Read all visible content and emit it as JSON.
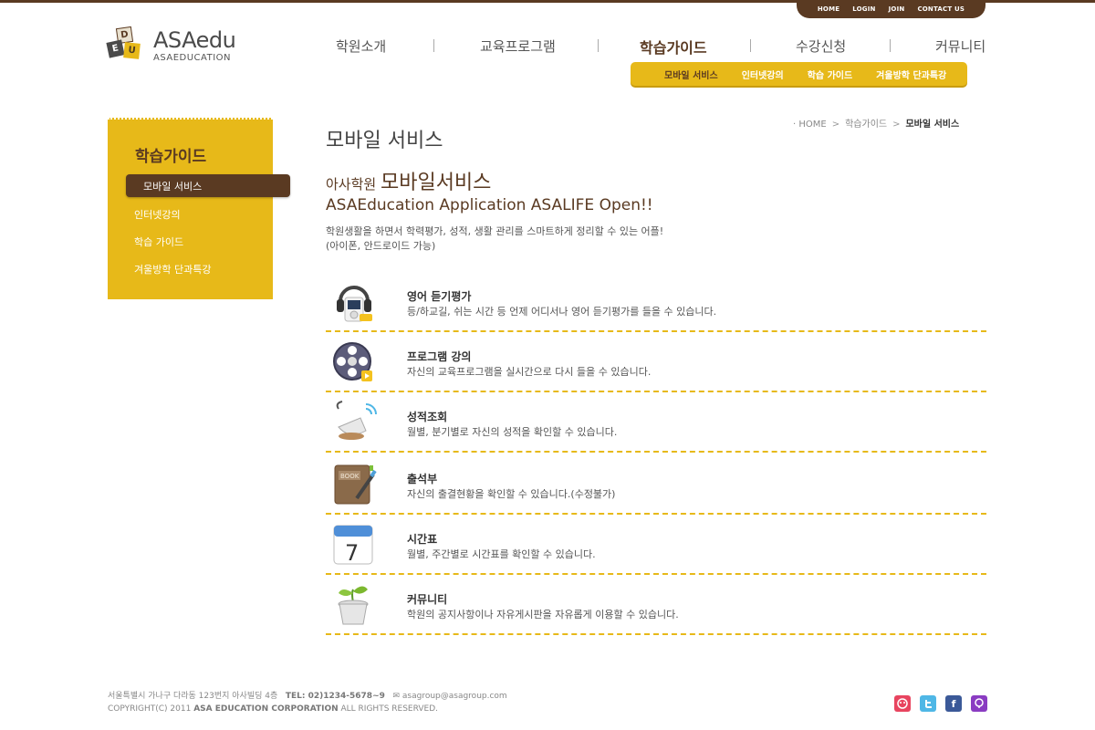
{
  "util_nav": [
    "HOME",
    "LOGIN",
    "JOIN",
    "CONTACT US"
  ],
  "logo": {
    "blocks": [
      "D",
      "E",
      "U"
    ],
    "name": "ASAedu",
    "sub": "ASAEDUCATION"
  },
  "gnb": [
    "학원소개",
    "교육프로그램",
    "학습가이드",
    "수강신청",
    "커뮤니티"
  ],
  "subnav": [
    "모바일 서비스",
    "인터넷강의",
    "학습 가이드",
    "겨울방학 단과특강"
  ],
  "lnb": {
    "title": "학습가이드",
    "items": [
      "모바일 서비스",
      "인터넷강의",
      "학습 가이드",
      "겨울방학 단과특강"
    ]
  },
  "page_title": "모바일 서비스",
  "breadcrumb": [
    "HOME",
    "학습가이드",
    "모바일 서비스"
  ],
  "heading": {
    "small": "아사학원 ",
    "big": "모바일서비스",
    "sub": "ASAEducation Application ASALIFE Open!!"
  },
  "description": [
    "학원생활을 하면서 학력평가, 성적, 생활 관리를 스마트하게 정리할 수 있는 어플!",
    "(아이폰, 안드로이드 가능)"
  ],
  "services": [
    {
      "title": "영어 듣기평가",
      "desc": "등/하교길, 쉬는 시간 등 언제 어디서나 영어 듣기평가를 들을 수 있습니다.",
      "icon": "headphones-mp3-icon"
    },
    {
      "title": "프로그램 강의",
      "desc": "자신의 교육프로그램을 실시간으로 다시 들을 수 있습니다.",
      "icon": "film-reel-icon"
    },
    {
      "title": "성적조회",
      "desc": "월별, 분기별로 자신의 성적을 확인할 수 있습니다.",
      "icon": "scale-icon"
    },
    {
      "title": "출석부",
      "desc": "자신의 출결현황을 확인할 수 있습니다.(수정불가)",
      "icon": "notebook-icon",
      "book_label": "BOOK"
    },
    {
      "title": "시간표",
      "desc": "월별, 주간별로 시간표를 확인할 수 있습니다.",
      "icon": "calendar-icon",
      "cal_day": "7"
    },
    {
      "title": "커뮤니티",
      "desc": "학원의 공지사항이나 자유게시판을 자유롭게 이용할 수 있습니다.",
      "icon": "sprout-pot-icon"
    }
  ],
  "footer": {
    "line1": "서울특별시 가나구 다라동 123번지 아사빌딩 4층",
    "tel": "TEL: 02)1234-5678~9",
    "email": "asagroup@asagroup.com",
    "line2_prefix": "COPYRIGHT(C) 2011 ",
    "line2_company": "ASA EDUCATION CORPORATION",
    "line2_suffix": " ALL RIGHTS RESERVED."
  },
  "social": [
    {
      "name": "me2day-icon",
      "color": "#e8445f"
    },
    {
      "name": "twitter-icon",
      "color": "#4fb7e6"
    },
    {
      "name": "facebook-icon",
      "color": "#3b5998",
      "glyph": "f"
    },
    {
      "name": "yozm-icon",
      "color": "#8a3cc2"
    }
  ]
}
